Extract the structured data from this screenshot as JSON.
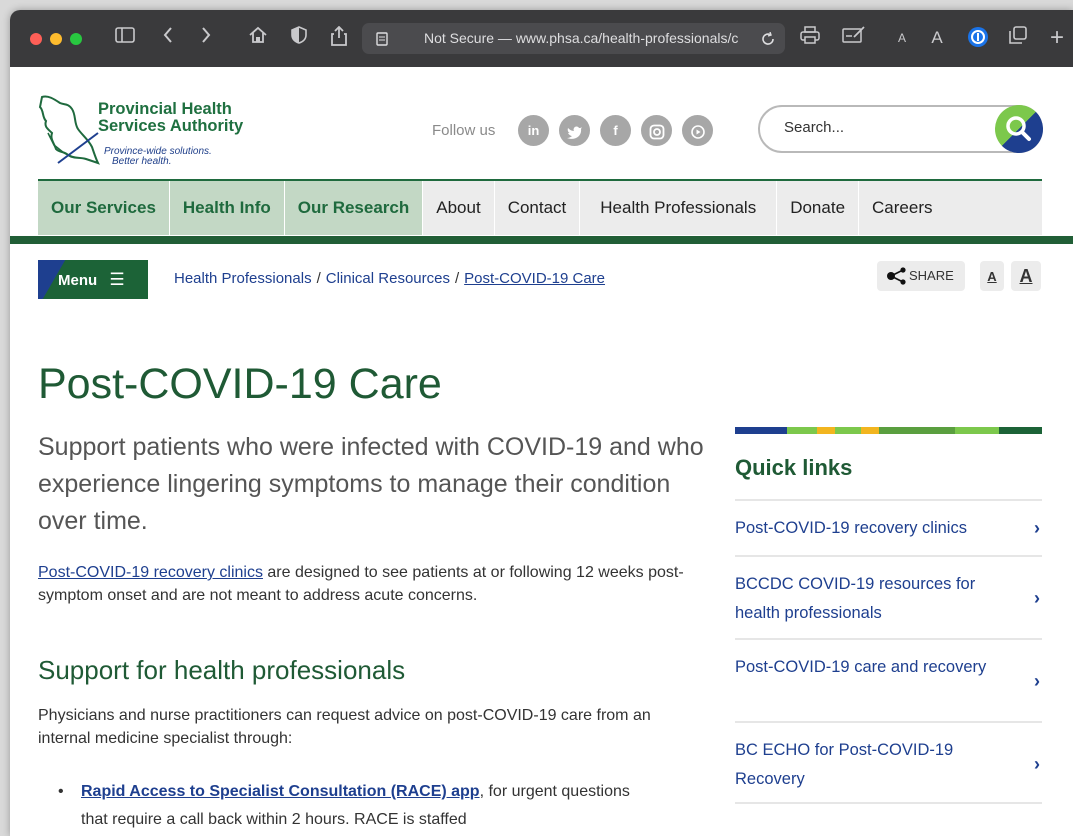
{
  "browser": {
    "url": "Not Secure — www.phsa.ca/health-professionals/c",
    "font_small": "A",
    "font_large": "A"
  },
  "header": {
    "org_line1": "Provincial Health",
    "org_line2": "Services Authority",
    "tagline1": "Province-wide solutions.",
    "tagline2": "Better health.",
    "follow_label": "Follow us",
    "social": [
      "in",
      "t",
      "f",
      "ig",
      "yt"
    ],
    "search_placeholder": "Search..."
  },
  "nav": {
    "items": [
      "Our Services",
      "Health Info",
      "Our Research",
      "About",
      "Contact",
      "Health Professionals",
      "Donate",
      "Careers"
    ]
  },
  "toolbar": {
    "menu_label": "Menu",
    "share_label": "SHARE",
    "font_small": "A",
    "font_large": "A"
  },
  "breadcrumb": {
    "items": [
      "Health Professionals",
      "Clinical Resources",
      "Post-COVID-19 Care"
    ]
  },
  "main": {
    "title": "Post-COVID-19 Care",
    "lede": "Support patients who were infected with COVID-19 and who experience lingering symptoms to manage their condition over time.",
    "para_link": "Post-COVID-19 recovery clinics",
    "para_text": " are designed to see patients at or following 12 weeks post-symptom onset and are not meant to address acute concerns.",
    "section_title": "Support for health professionals",
    "section_text": "Physicians and nurse practitioners can request advice on post-COVID-19 care from an internal medicine specialist through:",
    "bullet_link": "Rapid Access to Specialist Consultation (RACE) app",
    "bullet_text": ", for urgent questions that require a call back within 2 hours. RACE is staffed"
  },
  "quick_links": {
    "title": "Quick links",
    "items": [
      "Post-COVID-19 recovery clinics",
      "BCCDC COVID-19 resources for health professionals",
      "Post-COVID-19 care and recovery",
      "BC ECHO for Post-COVID-19 Recovery"
    ]
  },
  "colors": {
    "brand_green": "#1f6a3e",
    "brand_blue": "#1e3f8f",
    "accent_lime": "#7cc84c"
  }
}
